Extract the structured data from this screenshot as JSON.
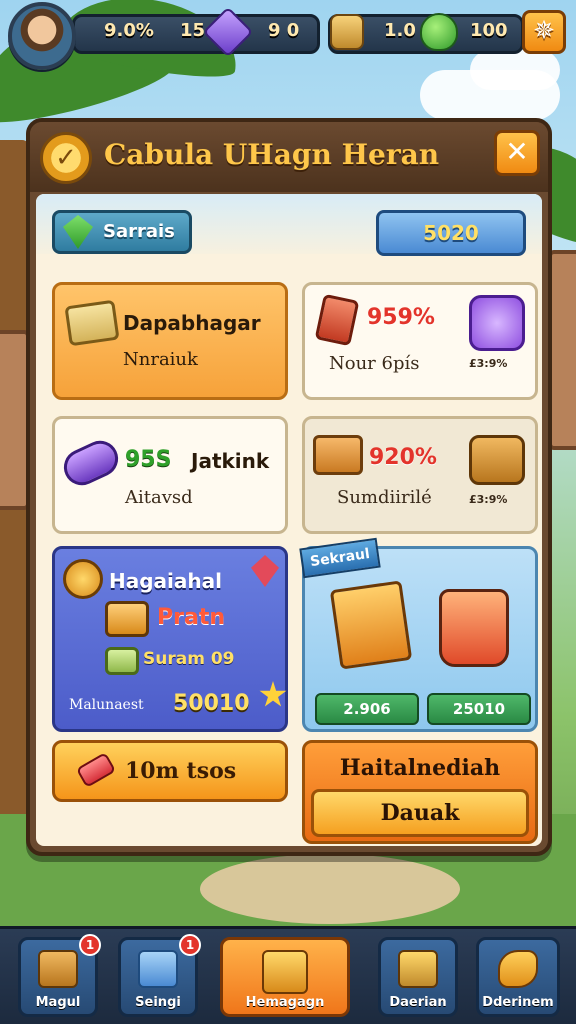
{
  "topbar": {
    "stat1": "9.0%",
    "stat2": "15",
    "stat3": "9 0",
    "stat4": "1.0",
    "stat5": "100",
    "plus_label": "✵"
  },
  "panel": {
    "title": "Cabula UHagn Heran",
    "close_label": "✕",
    "tag_left": "Sarrais",
    "tag_right": "5020"
  },
  "cards": {
    "c1": {
      "title": "Dapabhagar",
      "sub": "Nnraiuk"
    },
    "c2": {
      "pct": "959%",
      "sub": "Nour 6pís",
      "badge": "£3:9%"
    },
    "c3": {
      "pct": "95S",
      "title": "Jatkink",
      "sub": "Aitavsd"
    },
    "c4": {
      "pct": "920%",
      "sub": "Sumdiirilé",
      "badge": "£3:9%"
    },
    "c5": {
      "title": "Hagaiahal",
      "row2": "Pratn",
      "row3": "Suram 09",
      "foot_label": "Malunaest",
      "foot_value": "50010"
    },
    "c6": {
      "tag": "Sekraul",
      "price1": "2.906",
      "price2": "25010"
    }
  },
  "buttons": {
    "left": "10m tsos",
    "right_top": "Haitalnediah",
    "right_bottom": "Dauak"
  },
  "nav": [
    {
      "label": "Magul",
      "badge": "1"
    },
    {
      "label": "Seingi",
      "badge": "1"
    },
    {
      "label": "Hemagagn"
    },
    {
      "label": "Daerian"
    },
    {
      "label": "Dderinem"
    }
  ]
}
